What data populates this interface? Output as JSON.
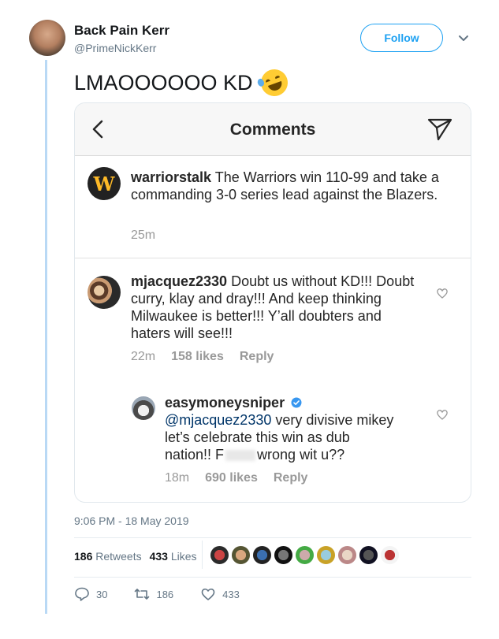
{
  "tweet": {
    "display_name": "Back Pain Kerr",
    "handle": "@PrimeNickKerr",
    "follow_label": "Follow",
    "text": "LMAOOOOOO KD",
    "emoji": "rolling-on-floor-laughing-emoji",
    "timestamp": "9:06 PM - 18 May 2019",
    "retweets_count": "186",
    "retweets_label": "Retweets",
    "likes_count": "433",
    "likes_label": "Likes",
    "actions": {
      "replies": "30",
      "retweets": "186",
      "likes": "433"
    }
  },
  "embedded": {
    "header_title": "Comments",
    "caption": {
      "username": "warriorstalk",
      "text": "The Warriors win 110-99 and take a commanding 3-0 series lead against the Blazers.",
      "time": "25m",
      "logo_letter": "W"
    },
    "comments": [
      {
        "username": "mjacquez2330",
        "text": "Doubt us without KD!!! Doubt curry, klay and dray!!! And keep thinking Milwaukee is better!!! Y’all doubters and haters will see!!!",
        "time": "22m",
        "likes": "158 likes",
        "reply": "Reply"
      },
      {
        "username": "easymoneysniper",
        "verified": true,
        "mention": "@mjacquez2330",
        "text_line1": "very divisive mikey",
        "text_line2": "let’s celebrate this win as dub",
        "text_line3_pre": "nation!! F",
        "text_line3_post": "wrong wit u??",
        "time": "18m",
        "likes": "690 likes",
        "reply": "Reply"
      }
    ]
  },
  "colors": {
    "twitter_blue": "#1da1f2",
    "thread_line": "#b9d9f5",
    "instagram_link": "#003569",
    "verified_blue": "#3897f0"
  }
}
